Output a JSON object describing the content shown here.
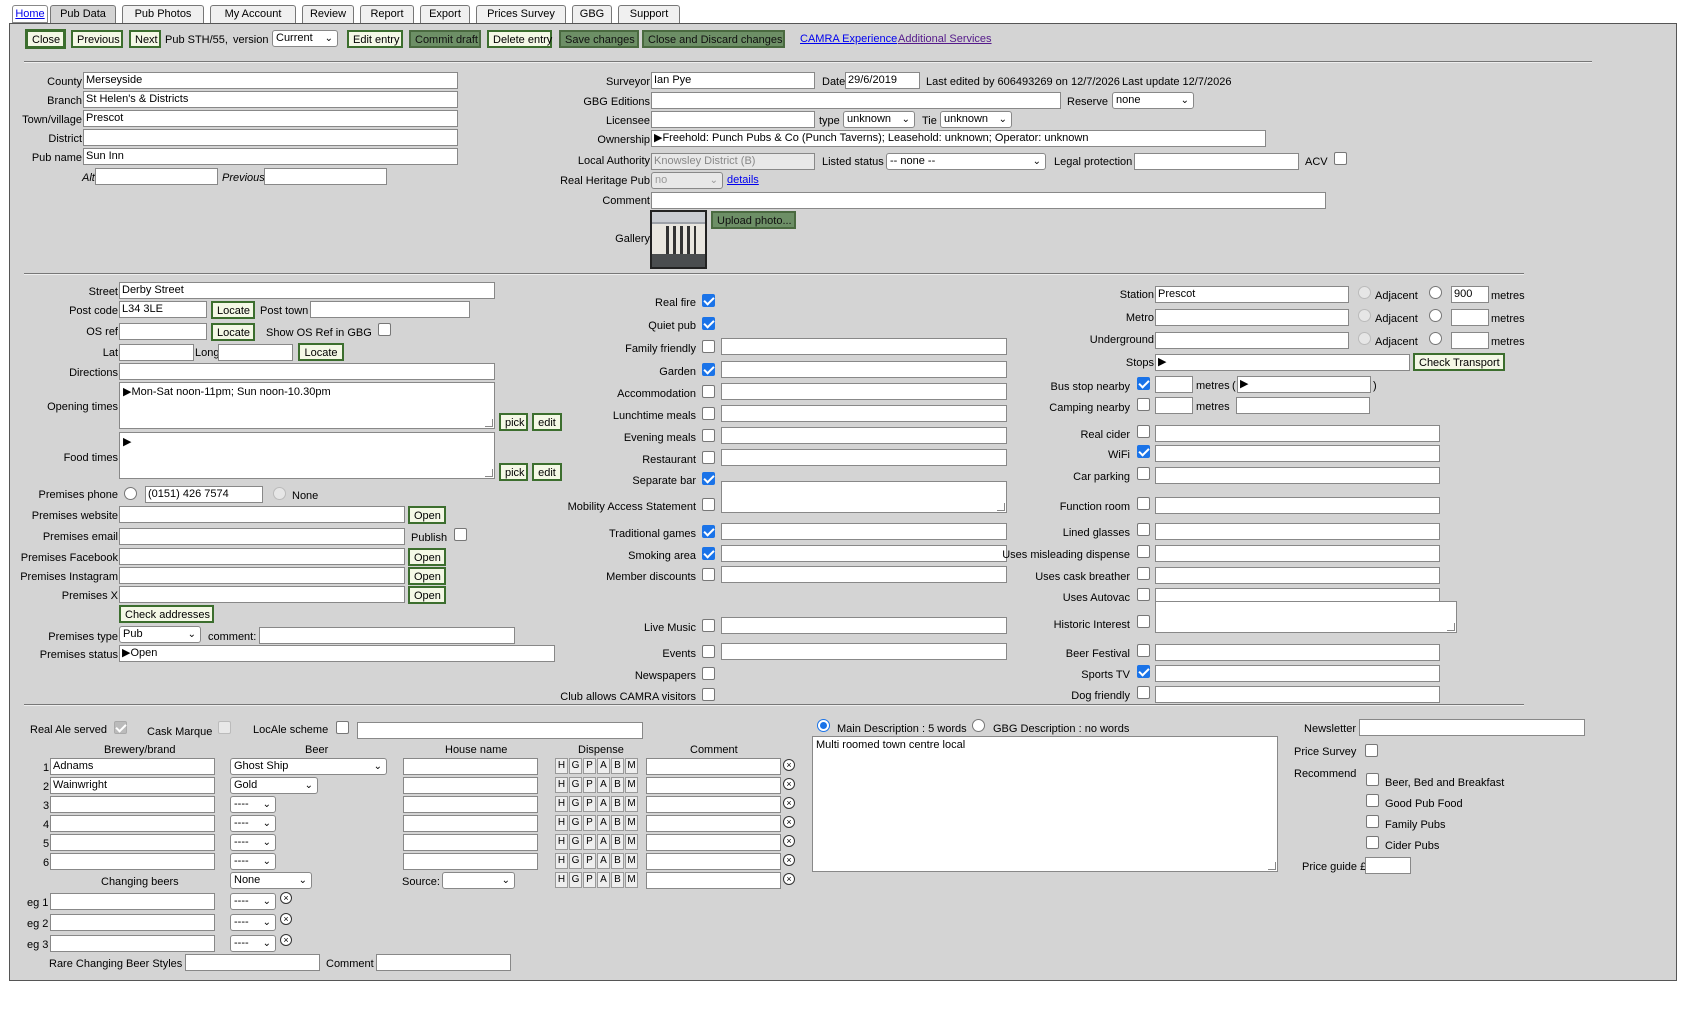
{
  "tabs": [
    "Home",
    "Pub Data",
    "Pub Photos",
    "My Account",
    "Review",
    "Report",
    "Export",
    "Prices Survey",
    "GBG",
    "Support"
  ],
  "toolbar": {
    "close": "Close",
    "previous": "Previous",
    "next": "Next",
    "pub_ref": "Pub STH/55,",
    "version_label": "version",
    "version_value": "Current",
    "edit_entry": "Edit entry",
    "commit_draft": "Commit draft",
    "delete_entry": "Delete entry",
    "save_changes": "Save changes",
    "close_discard": "Close and Discard changes",
    "camra_experience": "CAMRA Experience",
    "additional_services": "Additional Services"
  },
  "top": {
    "county_label": "County",
    "county": "Merseyside",
    "branch_label": "Branch",
    "branch": "St Helen's & Districts",
    "town_label": "Town/village",
    "town": "Prescot",
    "district_label": "District",
    "district": "",
    "pubname_label": "Pub name",
    "pubname": "Sun Inn",
    "alt_label": "Alt",
    "alt": "",
    "previous_label": "Previous",
    "previous": "",
    "surveyor_label": "Surveyor",
    "surveyor": "Ian Pye",
    "date_label": "Date",
    "date": "29/6/2019",
    "last_edited": "Last edited by 606493269 on 12/7/2026",
    "last_update": "Last update 12/7/2026",
    "gbg_label": "GBG Editions",
    "gbg": "",
    "reserve_label": "Reserve",
    "reserve": "none",
    "licensee_label": "Licensee",
    "licensee": "",
    "type_label": "type",
    "type": "unknown",
    "tie_label": "Tie",
    "tie": "unknown",
    "ownership_label": "Ownership",
    "ownership": "▶Freehold: Punch Pubs & Co (Punch Taverns); Leasehold: unknown; Operator: unknown",
    "la_label": "Local Authority",
    "la": "Knowsley District (B)",
    "listed_label": "Listed status",
    "listed": "-- none --",
    "legal_label": "Legal protection",
    "legal": "",
    "acv_label": "ACV",
    "heritage_label": "Real Heritage Pub",
    "heritage": "no",
    "details": "details",
    "comment_label": "Comment",
    "comment": "",
    "gallery_label": "Gallery",
    "upload": "Upload photo..."
  },
  "address": {
    "street_label": "Street",
    "street": "Derby Street",
    "postcode_label": "Post code",
    "postcode": "L34 3LE",
    "locate": "Locate",
    "posttown_label": "Post town",
    "posttown": "",
    "osref_label": "OS ref",
    "osref": "",
    "show_os": "Show OS Ref in GBG",
    "lat_label": "Lat",
    "lat": "",
    "long_label": "Long",
    "long": "",
    "directions_label": "Directions",
    "directions": "",
    "opening_label": "Opening times",
    "opening": "▶Mon-Sat noon-11pm; Sun noon-10.30pm",
    "food_label": "Food times",
    "food": "▶",
    "pick": "pick",
    "edit": "edit",
    "phone_label": "Premises phone",
    "phone": "(0151) 426 7574",
    "none": "None",
    "website_label": "Premises website",
    "email_label": "Premises email",
    "publish": "Publish",
    "facebook_label": "Premises Facebook",
    "instagram_label": "Premises Instagram",
    "x_label": "Premises X",
    "open": "Open",
    "check_addresses": "Check addresses",
    "ptype_label": "Premises type",
    "ptype": "Pub",
    "pcomment_label": "comment:",
    "status_label": "Premises status",
    "status": "▶Open"
  },
  "features": [
    {
      "label": "Real fire",
      "on": true
    },
    {
      "label": "Quiet pub",
      "on": true
    },
    {
      "label": "Family friendly",
      "on": false
    },
    {
      "label": "Garden",
      "on": true
    },
    {
      "label": "Accommodation",
      "on": false
    },
    {
      "label": "Lunchtime meals",
      "on": false
    },
    {
      "label": "Evening meals",
      "on": false
    },
    {
      "label": "Restaurant",
      "on": false
    },
    {
      "label": "Separate bar",
      "on": true
    },
    {
      "label": "Mobility Access Statement",
      "on": false
    },
    {
      "label": "Traditional games",
      "on": true
    },
    {
      "label": "Smoking area",
      "on": true
    },
    {
      "label": "Member discounts",
      "on": false
    },
    {
      "label": "Live Music",
      "on": false
    },
    {
      "label": "Events",
      "on": false
    },
    {
      "label": "Newspapers",
      "on": false
    },
    {
      "label": "Club allows CAMRA visitors",
      "on": false
    }
  ],
  "transport": {
    "station_label": "Station",
    "station": "Prescot",
    "adjacent": "Adjacent",
    "metres": "metres",
    "station_m": "900",
    "metro_label": "Metro",
    "underground_label": "Underground",
    "stops_label": "Stops",
    "stops": "▶",
    "check_transport": "Check Transport",
    "bus_label": "Bus stop nearby",
    "bus_extra": "▶",
    "camping_label": "Camping nearby"
  },
  "facilities": [
    {
      "label": "Real cider",
      "on": false
    },
    {
      "label": "WiFi",
      "on": true
    },
    {
      "label": "Car parking",
      "on": false
    },
    {
      "label": "Function room",
      "on": false
    },
    {
      "label": "Lined glasses",
      "on": false
    },
    {
      "label": "Uses misleading dispense",
      "on": false
    },
    {
      "label": "Uses cask breather",
      "on": false
    },
    {
      "label": "Uses Autovac",
      "on": false
    },
    {
      "label": "Historic Interest",
      "on": false
    },
    {
      "label": "Beer Festival",
      "on": false
    },
    {
      "label": "Sports TV",
      "on": true
    },
    {
      "label": "Dog friendly",
      "on": false
    }
  ],
  "beer": {
    "real_ale": "Real Ale served",
    "cask_marque": "Cask Marque",
    "locale": "LocAle scheme",
    "h_brewery": "Brewery/brand",
    "h_beer": "Beer",
    "h_house": "House name",
    "h_dispense": "Dispense",
    "h_comment": "Comment",
    "rows": [
      {
        "n": "1",
        "brewery": "Adnams",
        "beer": "Ghost Ship"
      },
      {
        "n": "2",
        "brewery": "Wainwright",
        "beer": "Gold"
      },
      {
        "n": "3",
        "brewery": "",
        "beer": "----"
      },
      {
        "n": "4",
        "brewery": "",
        "beer": "----"
      },
      {
        "n": "5",
        "brewery": "",
        "beer": "----"
      },
      {
        "n": "6",
        "brewery": "",
        "beer": "----"
      }
    ],
    "dispense_letters": [
      "H",
      "G",
      "P",
      "A",
      "B",
      "M"
    ],
    "changing_label": "Changing beers",
    "changing": "None",
    "source_label": "Source:",
    "eg": [
      {
        "label": "eg 1",
        "beer": "----"
      },
      {
        "label": "eg 2",
        "beer": "----"
      },
      {
        "label": "eg 3",
        "beer": "----"
      }
    ],
    "rare_label": "Rare Changing Beer Styles",
    "rare_comment_label": "Comment"
  },
  "desc": {
    "main_label": "Main Description : 5 words",
    "gbg_label": "GBG Description : no words",
    "text": "Multi roomed town centre local"
  },
  "side": {
    "newsletter_label": "Newsletter",
    "price_survey": "Price Survey",
    "recommend": "Recommend",
    "recs": [
      "Beer, Bed and Breakfast",
      "Good Pub Food",
      "Family Pubs",
      "Cider Pubs"
    ],
    "price_guide": "Price guide £"
  },
  "colors": {
    "button_border": "#3c6e2e",
    "panel": "#d4d4d4",
    "check": "#1a73e8"
  }
}
